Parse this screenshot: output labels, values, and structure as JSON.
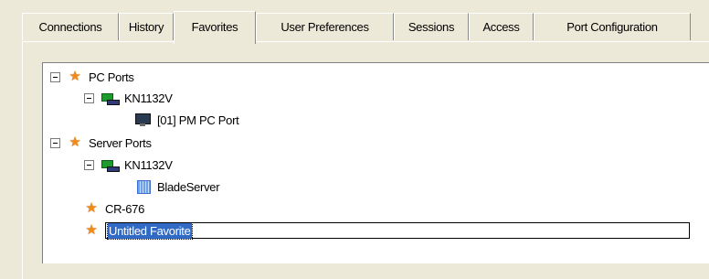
{
  "tabs": [
    {
      "label": "Connections",
      "active": false
    },
    {
      "label": "History",
      "active": false
    },
    {
      "label": "Favorites",
      "active": true
    },
    {
      "label": "User Preferences",
      "active": false
    },
    {
      "label": "Sessions",
      "active": false
    },
    {
      "label": "Access",
      "active": false
    },
    {
      "label": "Port Configuration",
      "active": false
    }
  ],
  "tree": {
    "pc_ports": "PC Ports",
    "kvm1": "KN1132V",
    "pc_port_item": "[01] PM PC Port",
    "server_ports": "Server Ports",
    "kvm2": "KN1132V",
    "blade_item": "BladeServer",
    "cr_item": "CR-676",
    "editing_item": "Untitled Favorite"
  },
  "icons": {
    "favorite": "star-icon",
    "switch": "kvm-switch-icon",
    "pc": "monitor-icon",
    "blade": "blade-server-icon"
  },
  "colors": {
    "selection": "#316ac5",
    "star": "#f08a1c",
    "background": "#ece9d8"
  }
}
